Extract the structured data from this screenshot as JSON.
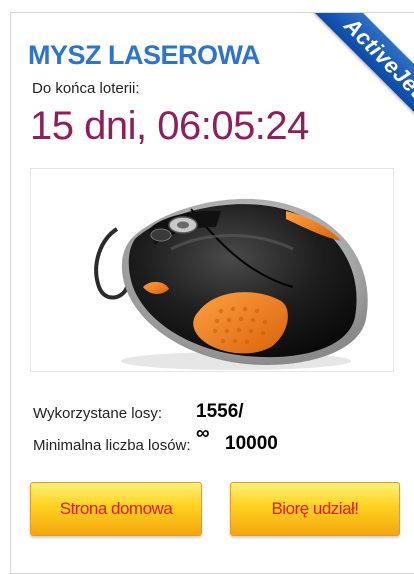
{
  "ribbon": {
    "label": "ActiveJet"
  },
  "product": {
    "title": "MYSZ LASEROWA",
    "countdown_label": "Do końca loterii:",
    "countdown_value": "15 dni, 06:05:24",
    "image_icon": "laser-mouse-image"
  },
  "stats": {
    "used_label": "Wykorzystane losy:",
    "used_value": "1556/∞",
    "min_label": "Minimalna liczba losów:",
    "min_value": "10000"
  },
  "buttons": {
    "home_label": "Strona domowa",
    "join_label": "Biorę udział!"
  },
  "colors": {
    "title": "#2d74cf",
    "timer": "#8f1e5a",
    "ribbon": "#0b4aa5",
    "button_text": "#dc1c1c",
    "button_fill": "#ffd21f",
    "mouse_body": "#1c1c1c",
    "mouse_accent": "#ef7f1a"
  }
}
